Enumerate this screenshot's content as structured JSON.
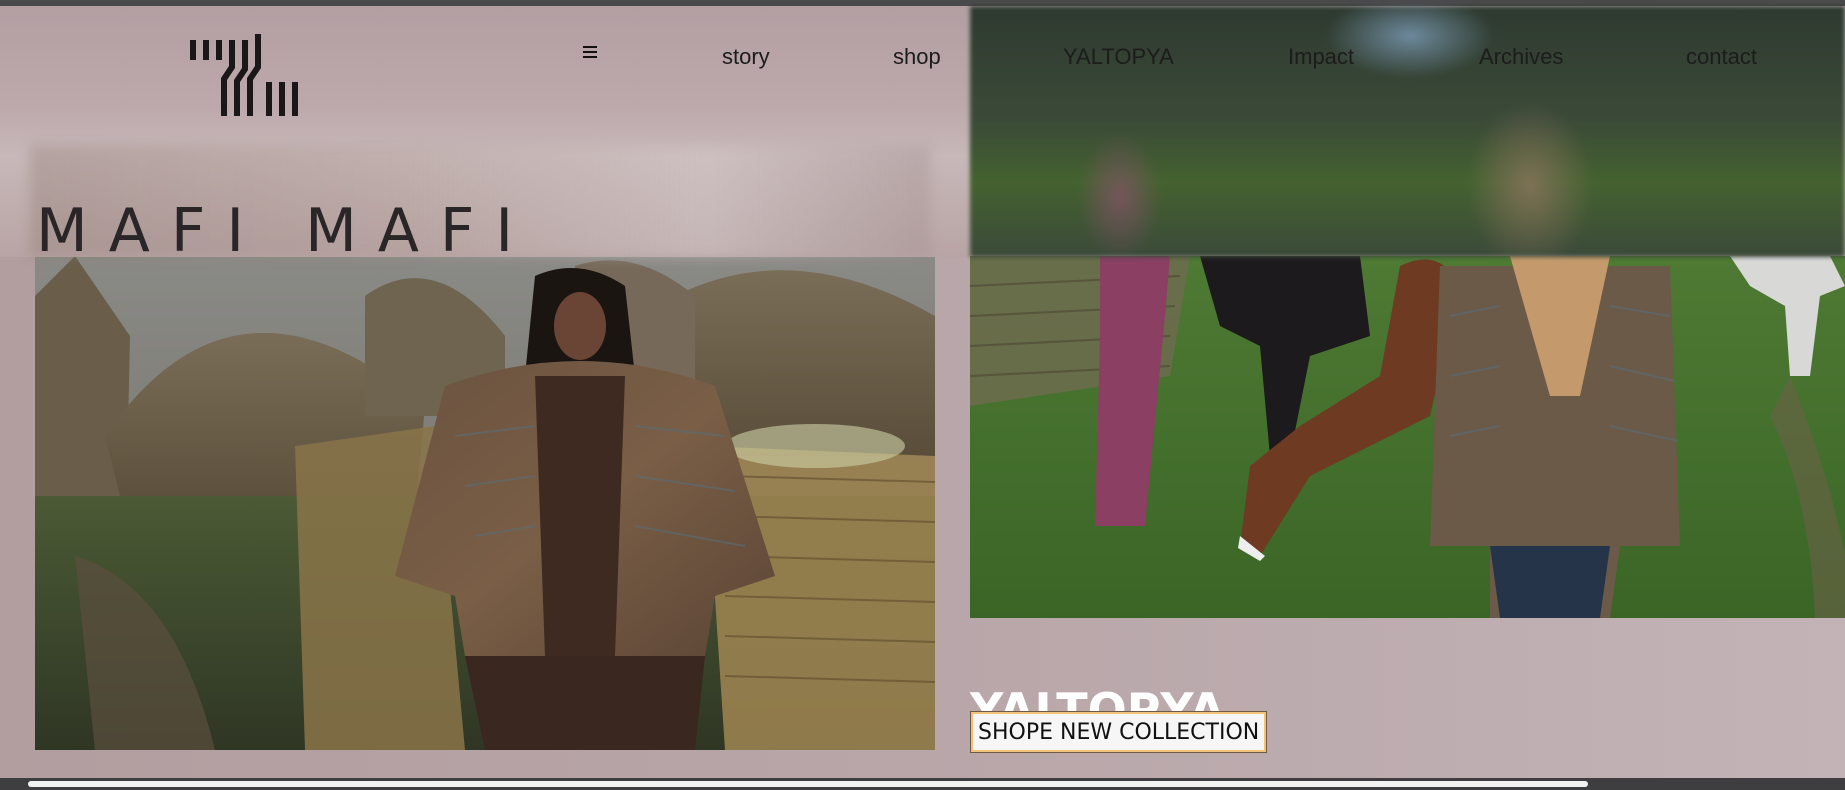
{
  "nav": {
    "menu_icon": "hamburger-icon",
    "items": [
      {
        "label": "story"
      },
      {
        "label": "shop"
      },
      {
        "label": "YALTOPYA"
      },
      {
        "label": "Impact"
      },
      {
        "label": "Archives"
      },
      {
        "label": "contact"
      }
    ]
  },
  "brand": {
    "title": "MAFI MAFI",
    "logo_icon": "mafi-mafi-logo"
  },
  "hero": {
    "collection_title": "YALTOPYA",
    "button_label": "SHOPE NEW COLLECTION",
    "left_image": "woman-in-jacket-by-huts-photo",
    "right_image": "people-with-horses-photo"
  },
  "colors": {
    "background": "#b9a7aa",
    "title_text": "#2a2526",
    "collection_title": "#ffffff",
    "button_border": "#f0c27a"
  }
}
